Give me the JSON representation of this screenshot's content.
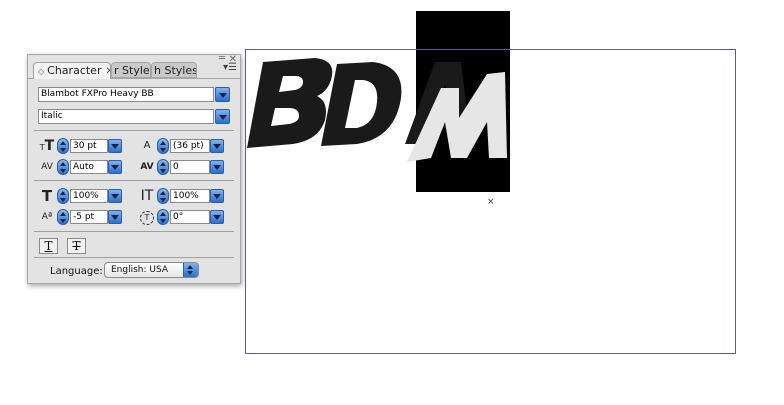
{
  "canvas": {
    "artwork_text": "BDAM",
    "center_marker": "×"
  },
  "panel": {
    "tabs": [
      {
        "label": "Character",
        "close": "✕"
      },
      {
        "label": "r Styles"
      },
      {
        "label": "h Styles"
      }
    ],
    "close_glyph": "✕",
    "minimize_glyph": "═",
    "menu_glyph": "▾☰",
    "font_family": "Blambot FXPro Heavy BB",
    "font_style": "Italic",
    "font_size": "30 pt",
    "leading": "(36 pt)",
    "kerning": "Auto",
    "tracking": "0",
    "horizontal_scale": "100%",
    "vertical_scale": "100%",
    "baseline_shift": "-5 pt",
    "character_rotation": "0°",
    "underline_glyph": "T",
    "strikethrough_glyph": "T",
    "language_label": "Language:",
    "language_value": "English: USA"
  },
  "icons": {
    "font_size": "T",
    "leading": "A",
    "kerning": "AV",
    "tracking": "AV",
    "horizontal_scale": "T",
    "vertical_scale": "IT",
    "baseline_shift": "Aª",
    "rotation": "T"
  }
}
